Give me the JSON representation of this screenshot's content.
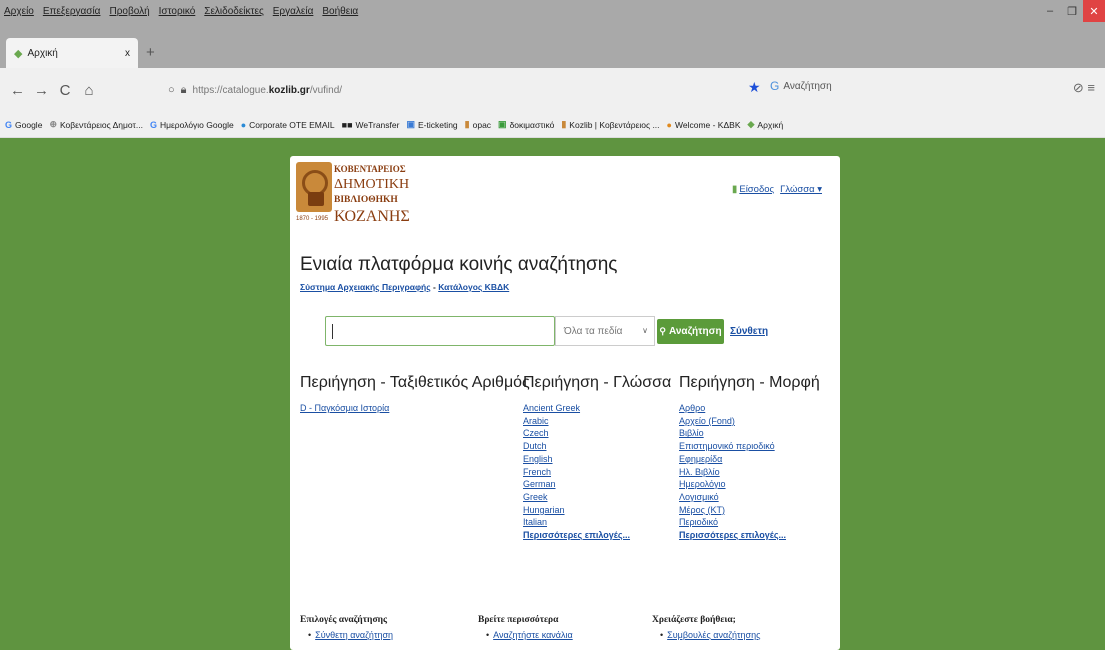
{
  "browser": {
    "menu": [
      "Αρχείο",
      "Επεξεργασία",
      "Προβολή",
      "Ιστορικό",
      "Σελιδοδείκτες",
      "Εργαλεία",
      "Βοήθεια"
    ],
    "window_controls": {
      "minimize": "–",
      "restore": "❐",
      "close": "✕"
    },
    "tab": {
      "title": "Αρχική",
      "close": "x"
    },
    "new_tab": "+",
    "nav": {
      "back": "←",
      "forward": "→",
      "reload": "C",
      "home": "⌂"
    },
    "url": {
      "prefix": "https://catalogue.",
      "host": "kozlib.gr",
      "path": "/vufind/"
    },
    "search_placeholder": "Αναζήτηση",
    "bookmarks": [
      {
        "icon": "G",
        "label": "Google"
      },
      {
        "icon": "⊕",
        "label": "Κοβεντάρειος Δημοτ..."
      },
      {
        "icon": "G",
        "label": "Ημερολόγιο Google"
      },
      {
        "icon": "●",
        "label": "Corporate OTE EMAIL"
      },
      {
        "icon": "■■",
        "label": "WeTransfer"
      },
      {
        "icon": "▣",
        "label": "E-ticketing"
      },
      {
        "icon": "▮",
        "label": "opac"
      },
      {
        "icon": "▣",
        "label": "δοκιμαστικό"
      },
      {
        "icon": "▮",
        "label": "Kozlib | Κοβεντάρειος ..."
      },
      {
        "icon": "●",
        "label": "Welcome - ΚΔΒΚ"
      },
      {
        "icon": "◆",
        "label": "Αρχική"
      }
    ]
  },
  "logo": {
    "line1": "ΚΟΒΕΝΤΑΡΕΙΟΣ",
    "line2": "ΔΗΜΟΤΙΚΗ",
    "line3": "ΒΙΒΛΙΟΘΗΚΗ",
    "line4": "ΚΟΖΑΝΗΣ",
    "small": "1870 - 1995"
  },
  "header": {
    "login": "Είσοδος",
    "language": "Γλώσσα ▾"
  },
  "main": {
    "title": "Ενιαία πλατφόρμα κοινής αναζήτησης",
    "sublinks": [
      "Σύστημα Αρχειακής Περιγραφής",
      "Κατάλογος ΚΒΔΚ"
    ],
    "sublink_sep": " - ",
    "search_value": "",
    "field_select": "Όλα τα πεδία",
    "search_button": "Αναζήτηση",
    "advanced": "Σύνθετη"
  },
  "browse": [
    {
      "heading": "Περιήγηση - Ταξιθετικός Αριθμός",
      "items": [
        "D - Παγκόσμια Ιστορία"
      ],
      "more": ""
    },
    {
      "heading": "Περιήγηση - Γλώσσα",
      "items": [
        "Ancient Greek",
        "Arabic",
        "Czech",
        "Dutch",
        "English",
        "French",
        "German",
        "Greek",
        "Hungarian",
        "Italian"
      ],
      "more": "Περισσότερες επιλογές..."
    },
    {
      "heading": "Περιήγηση - Μορφή",
      "items": [
        "Αρθρο",
        "Αρχείο (Fond)",
        "Βιβλίο",
        "Επιστημονικό περιοδικό",
        "Εφημερίδα",
        "Ηλ. Βιβλίο",
        "Ημερολόγιο",
        "Λογισμικό",
        "Μέρος (ΚΤ)",
        "Περιοδικό"
      ],
      "more": "Περισσότερες επιλογές..."
    }
  ],
  "footer": [
    {
      "heading": "Επιλογές αναζήτησης",
      "item": "Σύνθετη αναζήτηση"
    },
    {
      "heading": "Βρείτε περισσότερα",
      "item": "Αναζητήστε κανάλια"
    },
    {
      "heading": "Χρειάζεστε βοήθεια;",
      "item": "Συμβουλές αναζήτησης"
    }
  ]
}
